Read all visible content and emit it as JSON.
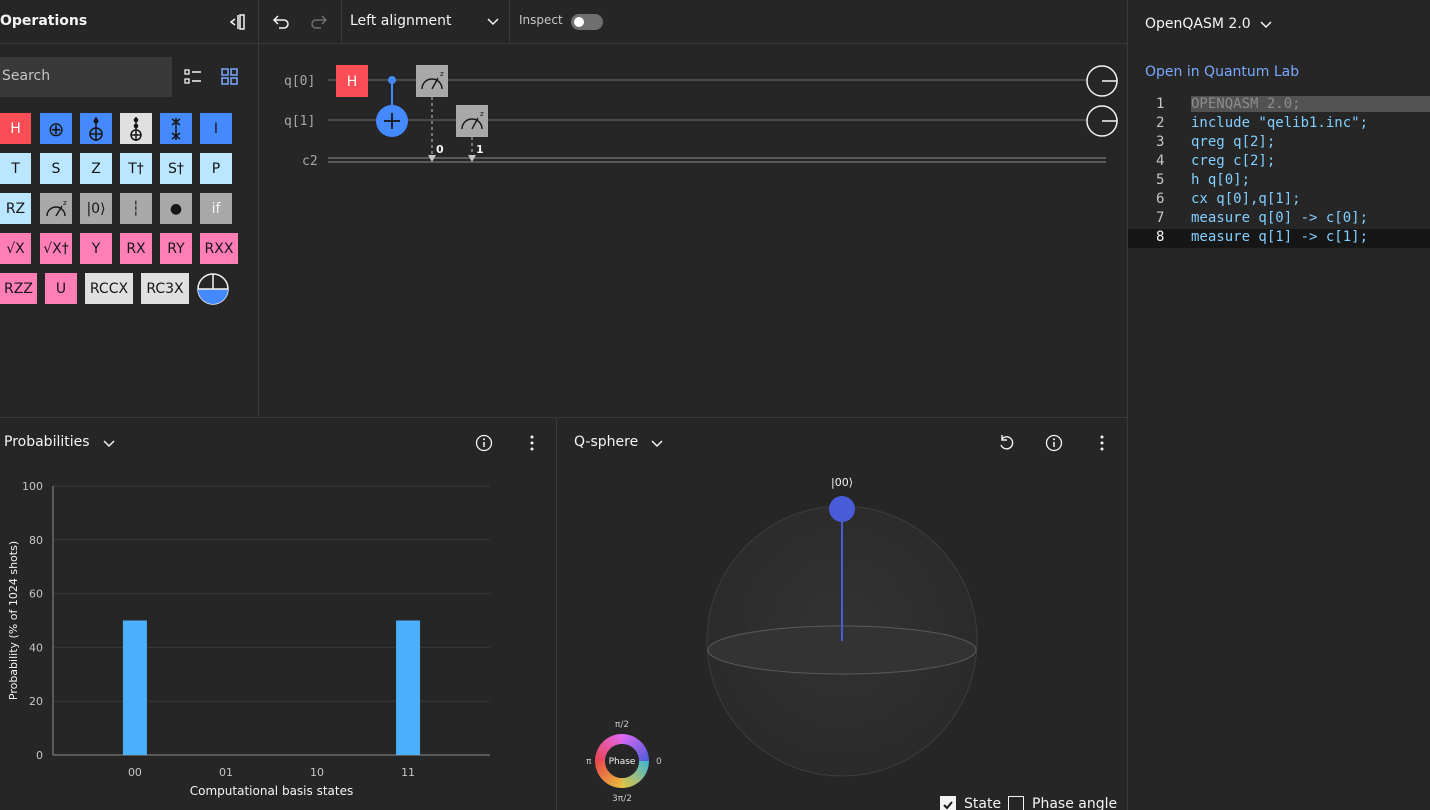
{
  "operations": {
    "title": "Operations",
    "search_placeholder": "Search",
    "gates": [
      {
        "label": "H"
      },
      {
        "label": "⊕"
      },
      {
        "label": ""
      },
      {
        "label": ""
      },
      {
        "label": ""
      },
      {
        "label": "I"
      },
      {
        "label": "T"
      },
      {
        "label": "S"
      },
      {
        "label": "Z"
      },
      {
        "label": "T†"
      },
      {
        "label": "S†"
      },
      {
        "label": "P"
      },
      {
        "label": "RZ"
      },
      {
        "label": ""
      },
      {
        "label": "|0⟩"
      },
      {
        "label": "┆"
      },
      {
        "label": "●"
      },
      {
        "label": "if"
      },
      {
        "label": "√X"
      },
      {
        "label": "√X†"
      },
      {
        "label": "Y"
      },
      {
        "label": "RX"
      },
      {
        "label": "RY"
      },
      {
        "label": "RXX"
      },
      {
        "label": "RZZ"
      },
      {
        "label": "U"
      },
      {
        "label": "RCCX"
      },
      {
        "label": "RC3X"
      },
      {
        "label": ""
      }
    ]
  },
  "toolbar": {
    "alignment": "Left alignment",
    "inspect_label": "Inspect"
  },
  "circuit": {
    "wires": [
      "q[0]",
      "q[1]",
      "c2"
    ],
    "h_gate": "H",
    "measure_bits": [
      "0",
      "1"
    ]
  },
  "code": {
    "language": "OpenQASM 2.0",
    "open_link": "Open in Quantum Lab",
    "lines": [
      {
        "n": "1",
        "text": "OPENQASM 2.0;"
      },
      {
        "n": "2",
        "text": "include \"qelib1.inc\";"
      },
      {
        "n": "3",
        "text": "qreg q[2];"
      },
      {
        "n": "4",
        "text": "creg c[2];"
      },
      {
        "n": "5",
        "text": "h q[0];"
      },
      {
        "n": "6",
        "text": "cx q[0],q[1];"
      },
      {
        "n": "7",
        "text": "measure q[0] -> c[0];"
      },
      {
        "n": "8",
        "text": "measure q[1] -> c[1];"
      }
    ]
  },
  "probabilities": {
    "title": "Probabilities"
  },
  "qsphere": {
    "title": "Q-sphere",
    "state_label": "|00⟩",
    "phase_label": "Phase",
    "phase_ticks": {
      "top": "π/2",
      "right": "0",
      "bottom": "3π/2",
      "left": "π"
    },
    "state_checkbox": "State",
    "phase_checkbox": "Phase angle"
  },
  "chart_data": {
    "type": "bar",
    "categories": [
      "00",
      "01",
      "10",
      "11"
    ],
    "values": [
      50,
      0,
      0,
      50
    ],
    "xlabel": "Computational basis states",
    "ylabel": "Probability (% of 1024 shots)",
    "ylim": [
      0,
      100
    ],
    "yticks": [
      0,
      20,
      40,
      60,
      80,
      100
    ],
    "color": "#4bb0ff"
  }
}
